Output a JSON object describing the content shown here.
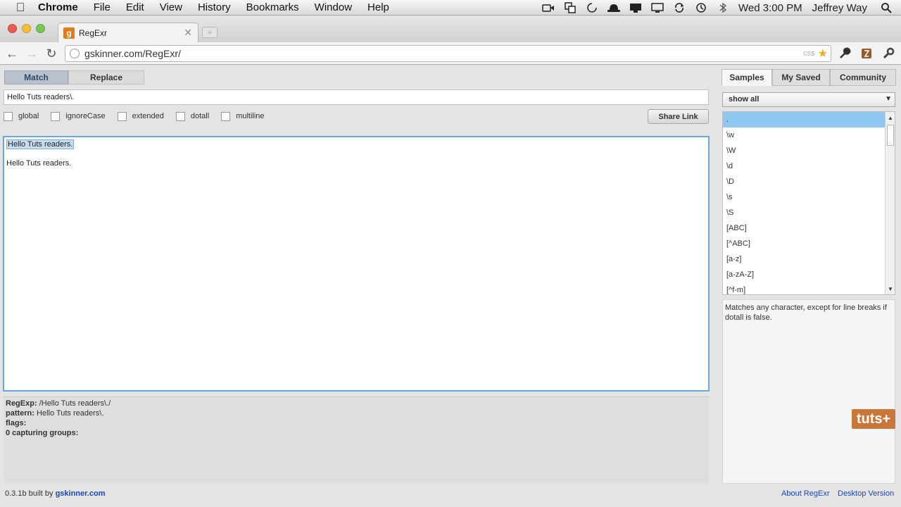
{
  "menubar": {
    "app": "Chrome",
    "items": [
      "File",
      "Edit",
      "View",
      "History",
      "Bookmarks",
      "Window",
      "Help"
    ],
    "clock": "Wed 3:00 PM",
    "user": "Jeffrey Way"
  },
  "browser": {
    "tab_title": "RegExr",
    "url": "gskinner.com/RegExr/",
    "css_badge": "css"
  },
  "app": {
    "mode_tabs": [
      "Match",
      "Replace"
    ],
    "active_mode": "Match",
    "regex_value": "Hello Tuts readers\\.",
    "flags": [
      "global",
      "ignoreCase",
      "extended",
      "dotall",
      "multiline"
    ],
    "share_label": "Share Link",
    "text_lines": [
      "Hello Tuts readers.",
      "Hello Tuts readers."
    ],
    "details": {
      "regexp_label": "RegExp:",
      "regexp_value": "/Hello Tuts readers\\./",
      "pattern_label": "pattern:",
      "pattern_value": "Hello Tuts readers\\.",
      "flags_label": "flags:",
      "flags_value": "",
      "groups_label": "0 capturing groups:"
    }
  },
  "sidebar": {
    "tabs": [
      "Samples",
      "My Saved",
      "Community"
    ],
    "active_tab": "Samples",
    "filter": "show all",
    "samples": [
      ".",
      "\\w",
      "\\W",
      "\\d",
      "\\D",
      "\\s",
      "\\S",
      "[ABC]",
      "[^ABC]",
      "[a-z]",
      "[a-zA-Z]",
      "[^f-m]"
    ],
    "selected_sample": ".",
    "description": "Matches any character, except for line breaks if dotall is false."
  },
  "footer": {
    "version_text": "0.3.1b built by ",
    "author_link": "gskinner.com",
    "about": "About RegExr",
    "desktop": "Desktop Version"
  },
  "watermark": "tuts+",
  "colors": {
    "selection": "#8ec7f0",
    "match_highlight": "#c6dcef",
    "link": "#1a47b8",
    "active_mode_tab": "#b9c2cc"
  }
}
